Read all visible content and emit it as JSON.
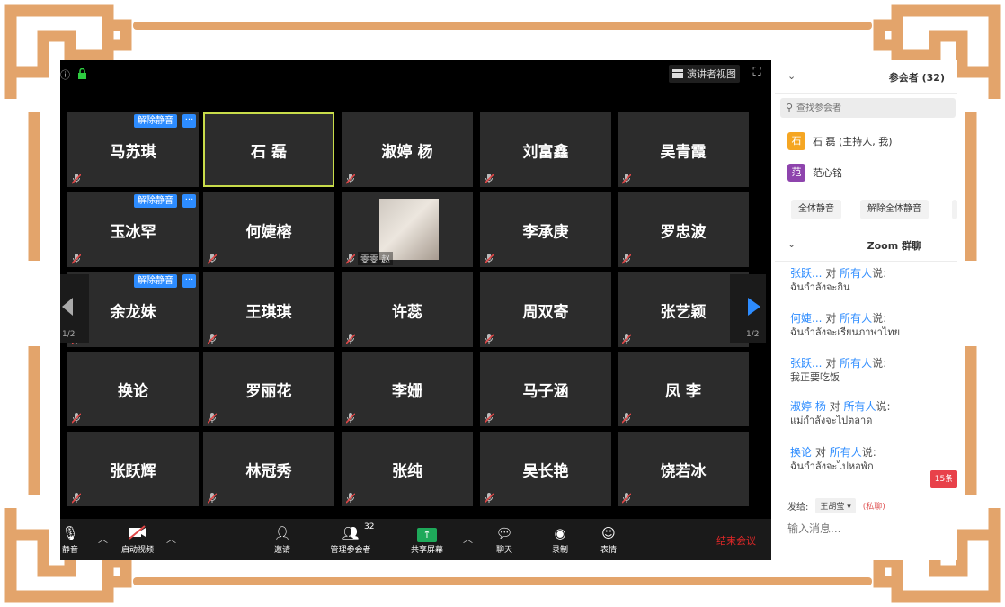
{
  "colors": {
    "frame": "#E3A46B",
    "tile_bg": "#2c2c2c",
    "active_border": "#c8dc4a",
    "accent_blue": "#2d8cff",
    "end_red": "#e02828",
    "share_green": "#1ea95a",
    "mic_red": "#e04848"
  },
  "topbar": {
    "presenter_view": "演讲者视图",
    "presenter_icon": "grid-icon",
    "fullscreen_icon": "fullscreen-icon",
    "info_icon": "info-icon",
    "lock_icon": "lock-icon"
  },
  "badges": {
    "unmute": "解除静音",
    "more": "···"
  },
  "grid": {
    "tiles": [
      {
        "name": "马苏琪",
        "badge": true
      },
      {
        "name": "石 磊",
        "active": true
      },
      {
        "name": "淑婷 杨"
      },
      {
        "name": "刘富鑫"
      },
      {
        "name": "吴青霞"
      },
      {
        "name": "玉冰罕",
        "badge": true
      },
      {
        "name": "何婕榕"
      },
      {
        "name": "",
        "video": true,
        "video_label": "雯雯 赵"
      },
      {
        "name": "李承庚"
      },
      {
        "name": "罗忠波"
      },
      {
        "name": "余龙妹",
        "badge": true
      },
      {
        "name": "王琪琪"
      },
      {
        "name": "许蕊"
      },
      {
        "name": "周双寄"
      },
      {
        "name": "张艺颖"
      },
      {
        "name": "换论"
      },
      {
        "name": "罗丽花"
      },
      {
        "name": "李姗"
      },
      {
        "name": "马子涵"
      },
      {
        "name": "凤 李"
      },
      {
        "name": "张跃辉"
      },
      {
        "name": "林冠秀"
      },
      {
        "name": "张纯"
      },
      {
        "name": "吴长艳"
      },
      {
        "name": "饶若冰"
      }
    ]
  },
  "pager": {
    "left": "1/2",
    "right": "1/2"
  },
  "toolbar": {
    "mute": "静音",
    "start_video": "启动视频",
    "invite": "邀请",
    "manage_participants": "管理参会者",
    "participant_count": "32",
    "share_screen": "共享屏幕",
    "chat": "聊天",
    "record": "录制",
    "reactions": "表情",
    "end_meeting": "结束会议"
  },
  "panel": {
    "participants_title": "参会者 (32)",
    "search_placeholder": "查找参会者",
    "participants": [
      {
        "avatar": "石",
        "name": "石 磊 (主持人, 我)",
        "color": "#f5a623"
      },
      {
        "avatar": "范",
        "name": "范心铭",
        "color": "#8e44ad"
      }
    ],
    "mute_all": "全体静音",
    "unmute_all": "解除全体静音",
    "chat_title": "Zoom 群聊",
    "to_word": "对",
    "everyone": "所有人",
    "said": "说:",
    "messages": [
      {
        "from": "张跃...",
        "body": "ฉันกำลังจะกิน"
      },
      {
        "from": "何婕...",
        "body": "ฉันกำลังจะเรียนภาษาไทย"
      },
      {
        "from": "张跃...",
        "body": "我正要吃饭"
      },
      {
        "from": "淑婷 杨",
        "body": "แม่กำลังจะไปตลาด"
      },
      {
        "from": "换论",
        "body": "ฉันกำลังจะไปหอพัก"
      }
    ],
    "unread": "15条",
    "send_to_label": "发给:",
    "send_to_value": "王胡莹 ▾",
    "private": "(私聊)",
    "input_placeholder": "输入消息..."
  }
}
